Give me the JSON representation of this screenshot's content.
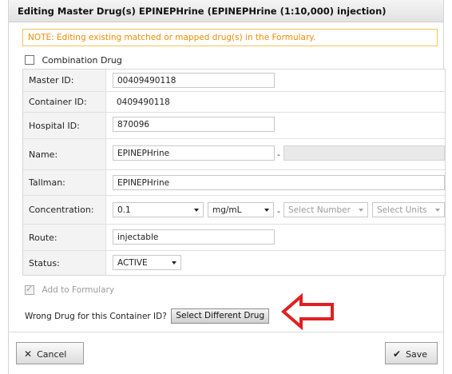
{
  "dialog": {
    "title": "Editing Master Drug(s) EPINEPHrine (EPINEPHrine (1:10,000) injection)",
    "note": "NOTE: Editing existing matched or mapped drug(s) in the Formulary."
  },
  "combination": {
    "label": "Combination Drug",
    "checked": false
  },
  "form": {
    "master_id": {
      "label": "Master ID:",
      "value": "00409490118"
    },
    "container_id": {
      "label": "Container ID:",
      "value": "0409490118"
    },
    "hospital_id": {
      "label": "Hospital ID:",
      "value": "870096"
    },
    "name": {
      "label": "Name:",
      "value": "EPINEPHrine",
      "suffix": ""
    },
    "tallman": {
      "label": "Tallman:",
      "value": "EPINEPHrine"
    },
    "concentration": {
      "label": "Concentration:",
      "value": "0.1",
      "unit": "mg/mL",
      "number_placeholder": "Select Number",
      "units_placeholder": "Select Units"
    },
    "route": {
      "label": "Route:",
      "value": "injectable"
    },
    "status": {
      "label": "Status:",
      "value": "ACTIVE"
    }
  },
  "add_formulary": {
    "label": "Add to Formulary",
    "checked": true,
    "disabled": true
  },
  "wrong_drug": {
    "text": "Wrong Drug for this Container ID?",
    "button": "Select Different Drug"
  },
  "footer": {
    "cancel": "Cancel",
    "save": "Save"
  },
  "colors": {
    "note_border": "#f2c35a",
    "note_text": "#f08c00",
    "annotation_arrow": "#e02020"
  },
  "icons": {
    "cancel": "close-icon",
    "save": "checkmark-icon",
    "arrow": "left-arrow-annotation-icon"
  }
}
